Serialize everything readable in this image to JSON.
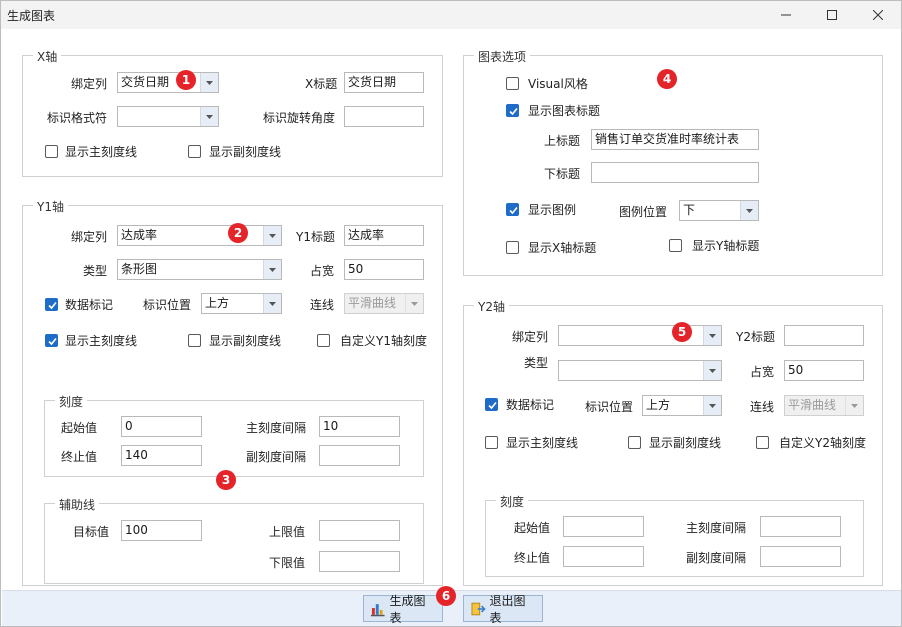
{
  "window": {
    "title": "生成图表"
  },
  "x_axis": {
    "legend": "X轴",
    "bind_label": "绑定列",
    "bind_value": "交货日期",
    "title_label": "X标题",
    "title_value": "交货日期",
    "format_label": "标识格式符",
    "format_value": "",
    "rotation_label": "标识旋转角度",
    "rotation_value": "",
    "show_major_label": "显示主刻度线",
    "show_minor_label": "显示副刻度线"
  },
  "y1_axis": {
    "legend": "Y1轴",
    "bind_label": "绑定列",
    "bind_value": "达成率",
    "title_label": "Y1标题",
    "title_value": "达成率",
    "type_label": "类型",
    "type_value": "条形图",
    "width_label": "占宽",
    "width_value": "50",
    "data_marker_label": "数据标记",
    "marker_pos_label": "标识位置",
    "marker_pos_value": "上方",
    "line_label": "连线",
    "line_value": "平滑曲线",
    "show_major_label": "显示主刻度线",
    "show_minor_label": "显示副刻度线",
    "custom_scale_label": "自定义Y1轴刻度",
    "scale": {
      "legend": "刻度",
      "start_label": "起始值",
      "start_value": "0",
      "major_label": "主刻度间隔",
      "major_value": "10",
      "end_label": "终止值",
      "end_value": "140",
      "minor_label": "副刻度间隔",
      "minor_value": ""
    },
    "guide": {
      "legend": "辅助线",
      "target_label": "目标值",
      "target_value": "100",
      "upper_label": "上限值",
      "upper_value": "",
      "lower_label": "下限值",
      "lower_value": ""
    }
  },
  "chart_options": {
    "legend": "图表选项",
    "visual_label": "Visual风格",
    "show_title_label": "显示图表标题",
    "top_title_label": "上标题",
    "top_title_value": "销售订单交货准时率统计表",
    "bottom_title_label": "下标题",
    "bottom_title_value": "",
    "show_legend_label": "显示图例",
    "legend_pos_label": "图例位置",
    "legend_pos_value": "下",
    "show_x_title_label": "显示X轴标题",
    "show_y_title_label": "显示Y轴标题"
  },
  "y2_axis": {
    "legend": "Y2轴",
    "bind_label": "绑定列",
    "bind_value": "",
    "title_label": "Y2标题",
    "title_value": "",
    "type_label": "类型",
    "type_value": "",
    "width_label": "占宽",
    "width_value": "50",
    "data_marker_label": "数据标记",
    "marker_pos_label": "标识位置",
    "marker_pos_value": "上方",
    "line_label": "连线",
    "line_value": "平滑曲线",
    "show_major_label": "显示主刻度线",
    "show_minor_label": "显示副刻度线",
    "custom_scale_label": "自定义Y2轴刻度",
    "scale": {
      "legend": "刻度",
      "start_label": "起始值",
      "start_value": "",
      "major_label": "主刻度间隔",
      "major_value": "",
      "end_label": "终止值",
      "end_value": "",
      "minor_label": "副刻度间隔",
      "minor_value": ""
    }
  },
  "footer": {
    "generate_label": "生成图表",
    "exit_label": "退出图表"
  },
  "badges": [
    "1",
    "2",
    "3",
    "4",
    "5",
    "6"
  ],
  "colors": {
    "accent": "#1e6bc8",
    "badge": "#e5242a",
    "footer_bg": "#e9f0f9"
  }
}
